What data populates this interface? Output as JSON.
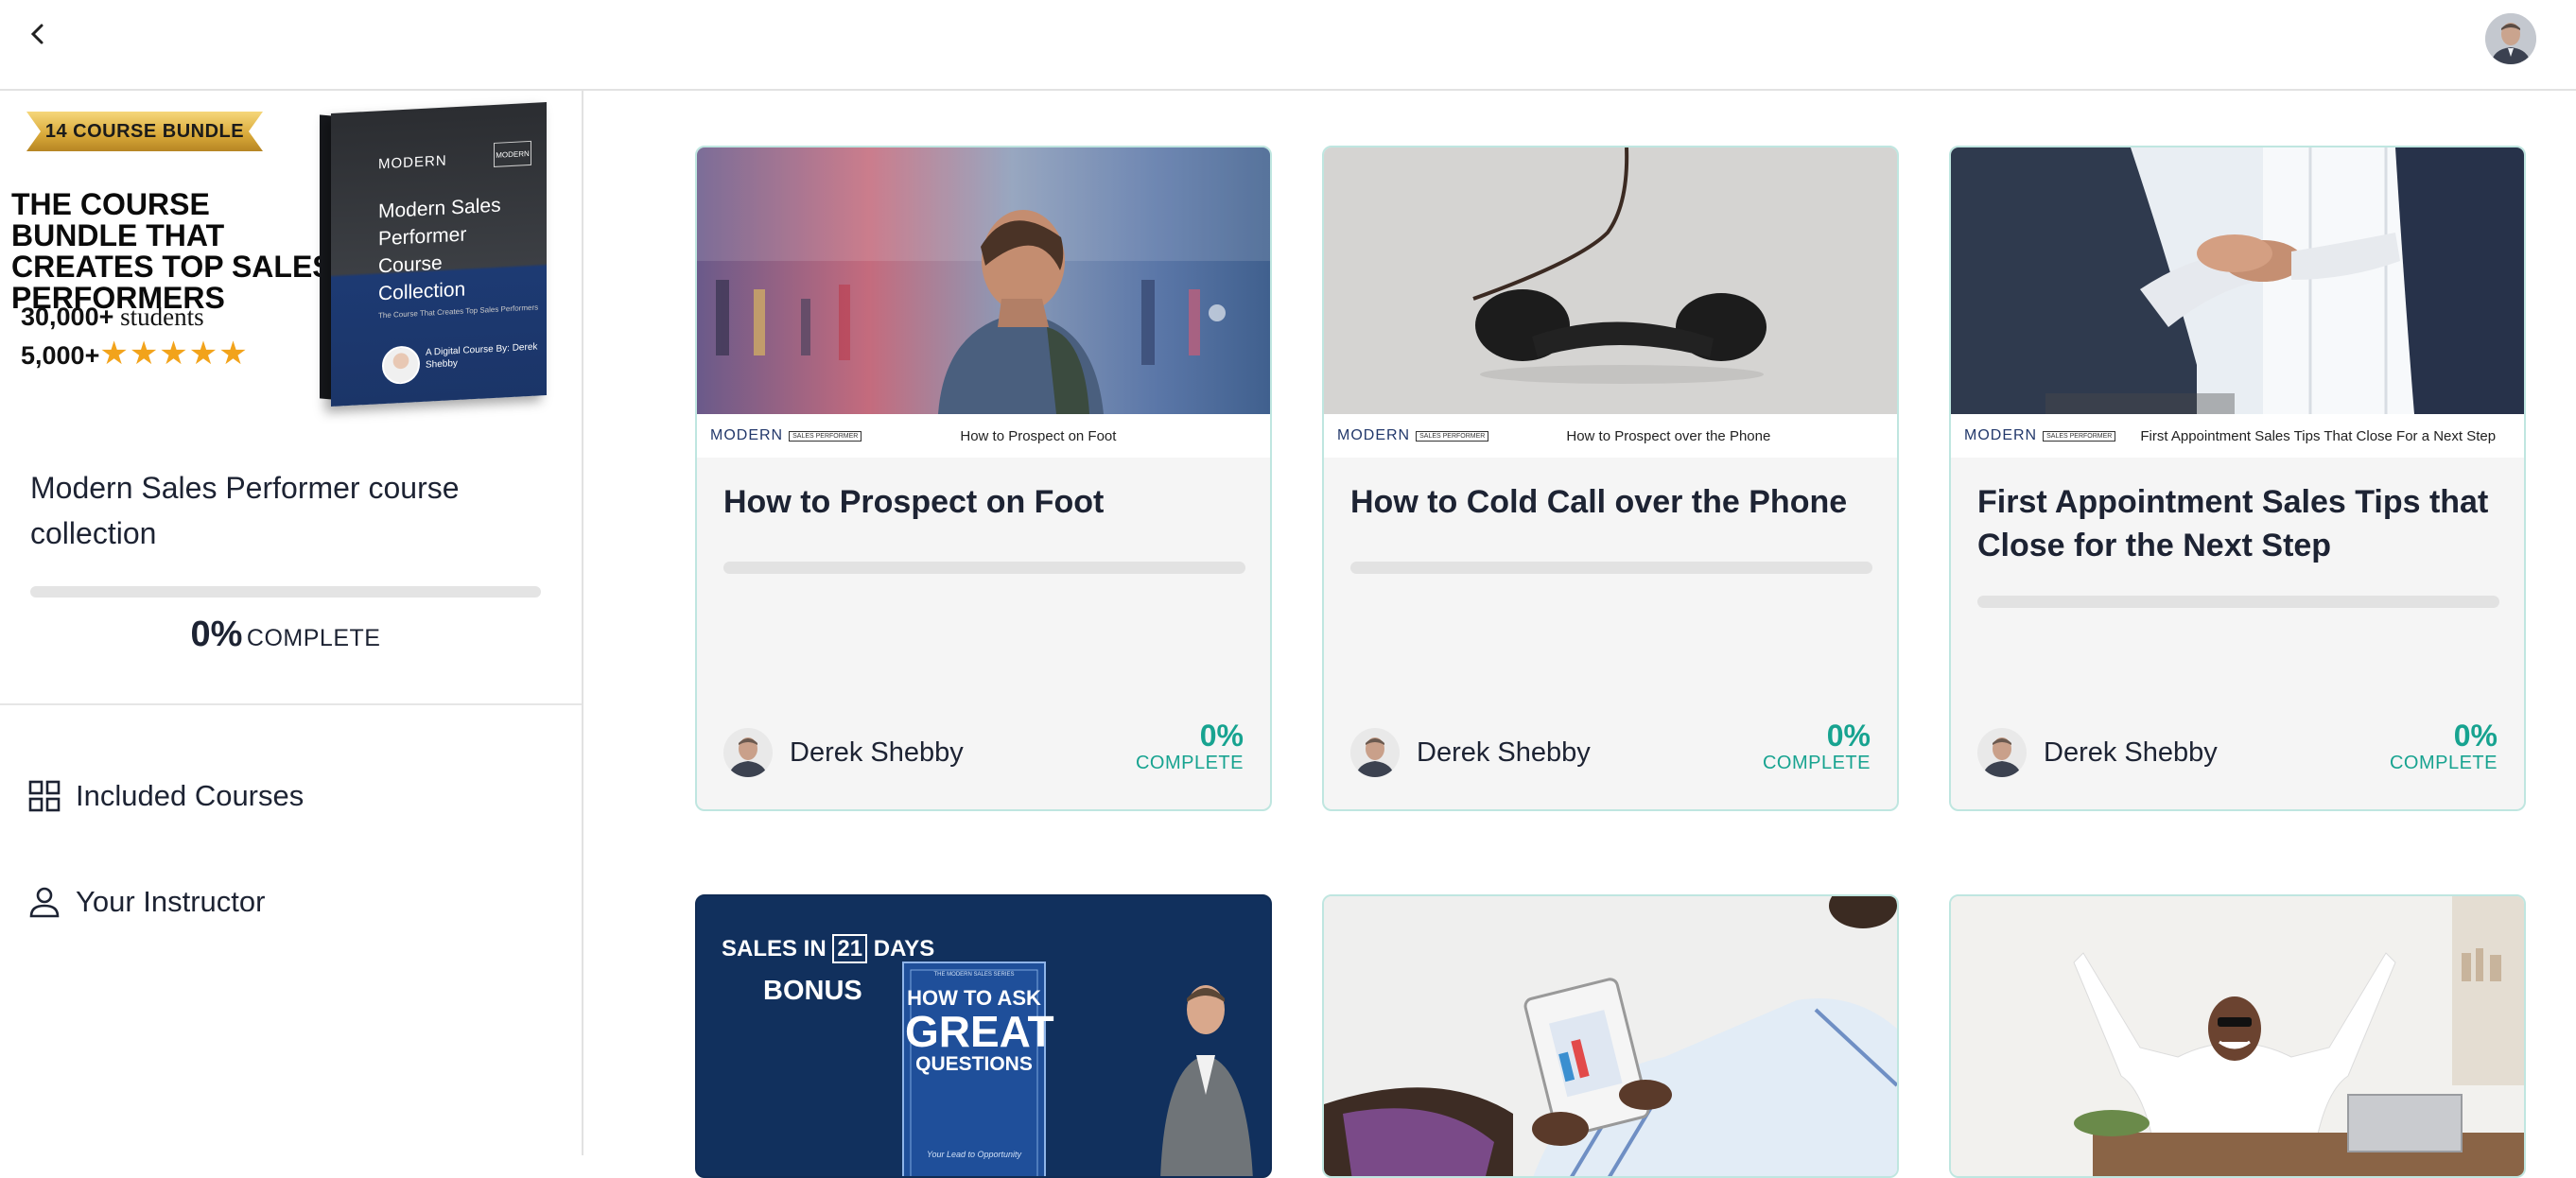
{
  "topbar": {
    "back_icon": "chevron-left-icon",
    "avatar": "instructor-avatar"
  },
  "promo": {
    "ribbon": "14 COURSE BUNDLE",
    "headline": "THE COURSE BUNDLE THAT CREATES TOP SALES PERFORMERS",
    "stat_students_num": "30,000+",
    "stat_students_txt": " students",
    "stat_reviews_num": "5,000+",
    "stars": "★★★★★",
    "box": {
      "brand": "MODERN",
      "title": "Modern Sales Performer Course Collection",
      "subtitle": "The Course That Creates Top Sales Performers",
      "author": "A Digital Course By: Derek Shebby"
    }
  },
  "collection": {
    "title": "Modern Sales Performer course collection",
    "progress_pct": 0,
    "pct_text": "0%",
    "complete_label": "COMPLETE"
  },
  "nav": [
    {
      "label": "Included Courses",
      "icon": "grid-icon"
    },
    {
      "label": "Your Instructor",
      "icon": "person-icon"
    }
  ],
  "courses": [
    {
      "title": "How to Prospect on Foot",
      "banner_logo": "MODERN",
      "banner_tag": "SALES PERFORMER",
      "banner_text": "How to Prospect on Foot",
      "author": "Derek Shebby",
      "pct": "0%",
      "complete": "COMPLETE"
    },
    {
      "title": "How to Cold Call over the Phone",
      "banner_logo": "MODERN",
      "banner_tag": "SALES PERFORMER",
      "banner_text": "How to Prospect over the Phone",
      "author": "Derek Shebby",
      "pct": "0%",
      "complete": "COMPLETE"
    },
    {
      "title": "First Appointment Sales Tips that Close for the Next Step",
      "banner_logo": "MODERN",
      "banner_tag": "SALES PERFORMER",
      "banner_text": "First Appointment Sales Tips That Close For a Next Step",
      "author": "Derek Shebby",
      "pct": "0%",
      "complete": "COMPLETE"
    }
  ],
  "row2": {
    "bonus_card": {
      "top_text_a": "SALES IN",
      "top_num": "21",
      "top_text_b": "DAYS",
      "bonus": "BONUS",
      "book_series": "THE MODERN SALES SERIES",
      "book_line1": "HOW TO ASK",
      "book_line2": "GREAT",
      "book_line3": "QUESTIONS",
      "book_tagline": "Your Lead to Opportunity"
    }
  },
  "colors": {
    "accent": "#17a390",
    "card_border": "#bfe6e0",
    "text": "#1d2333"
  }
}
